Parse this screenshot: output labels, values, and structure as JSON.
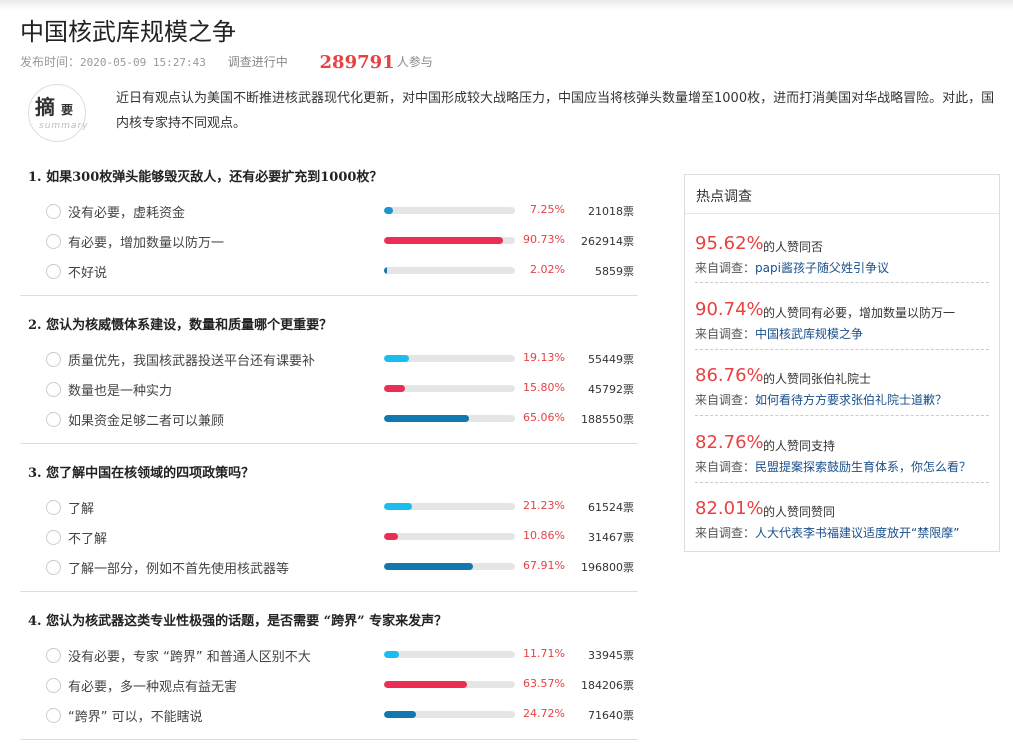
{
  "page": {
    "title": "中国核武库规模之争",
    "meta": {
      "time_label": "发布时间：",
      "time": "2020-05-09 15:27:43",
      "status": "调查进行中",
      "participants": "289791",
      "participants_unit": "人参与"
    },
    "summary": {
      "badge_big": "摘",
      "badge_small": "要",
      "badge_en": "summary",
      "text": "近日有观点认为美国不断推进核武器现代化更新，对中国形成较大战略压力，中国应当将核弹头数量增至1000枚，进而打消美国对华战略冒险。对此，国内核专家持不同观点。"
    }
  },
  "questions": [
    {
      "title": "1. 如果300枚弹头能够毁灭敌人，还有必要扩充到1000枚？",
      "options": [
        {
          "label": "没有必要，虚耗资金",
          "percent_text": "7.25%",
          "percent": 7.25,
          "votes": "21018票",
          "color": "#1a96d4"
        },
        {
          "label": "有必要，增加数量以防万一",
          "percent_text": "90.73%",
          "percent": 90.73,
          "votes": "262914票",
          "color": "#ec2d54"
        },
        {
          "label": "不好说",
          "percent_text": "2.02%",
          "percent": 2.02,
          "votes": "5859票",
          "color": "#1278b0"
        }
      ]
    },
    {
      "title": "2. 您认为核威慑体系建设，数量和质量哪个更重要？",
      "options": [
        {
          "label": "质量优先，我国核武器投送平台还有课要补",
          "percent_text": "19.13%",
          "percent": 19.13,
          "votes": "55449票",
          "color": "#19bdf0"
        },
        {
          "label": "数量也是一种实力",
          "percent_text": "15.80%",
          "percent": 15.8,
          "votes": "45792票",
          "color": "#ec2d54"
        },
        {
          "label": "如果资金足够二者可以兼顾",
          "percent_text": "65.06%",
          "percent": 65.06,
          "votes": "188550票",
          "color": "#1278b0"
        }
      ]
    },
    {
      "title": "3. 您了解中国在核领域的四项政策吗？",
      "options": [
        {
          "label": "了解",
          "percent_text": "21.23%",
          "percent": 21.23,
          "votes": "61524票",
          "color": "#19bdf0"
        },
        {
          "label": "不了解",
          "percent_text": "10.86%",
          "percent": 10.86,
          "votes": "31467票",
          "color": "#ec2d54"
        },
        {
          "label": "了解一部分，例如不首先使用核武器等",
          "percent_text": "67.91%",
          "percent": 67.91,
          "votes": "196800票",
          "color": "#1278b0"
        }
      ]
    },
    {
      "title": "4. 您认为核武器这类专业性极强的话题，是否需要 “跨界” 专家来发声？",
      "options": [
        {
          "label": "没有必要，专家 “跨界” 和普通人区别不大",
          "percent_text": "11.71%",
          "percent": 11.71,
          "votes": "33945票",
          "color": "#19bdf0"
        },
        {
          "label": "有必要，多一种观点有益无害",
          "percent_text": "63.57%",
          "percent": 63.57,
          "votes": "184206票",
          "color": "#ec2d54"
        },
        {
          "label": "“跨界” 可以，不能瞎说",
          "percent_text": "24.72%",
          "percent": 24.72,
          "votes": "71640票",
          "color": "#1278b0"
        }
      ]
    }
  ],
  "hot": {
    "title": "热点调查",
    "items": [
      {
        "percent": "95.62%",
        "text": "的人赞同否",
        "source_label": "来自调查：",
        "source": "papi酱孩子随父姓引争议"
      },
      {
        "percent": "90.74%",
        "text": "的人赞同有必要，增加数量以防万一",
        "source_label": "来自调查：",
        "source": "中国核武库规模之争"
      },
      {
        "percent": "86.76%",
        "text": "的人赞同张伯礼院士",
        "source_label": "来自调查：",
        "source": "如何看待方方要求张伯礼院士道歉？"
      },
      {
        "percent": "82.76%",
        "text": "的人赞同支持",
        "source_label": "来自调查：",
        "source": "民盟提案探索鼓励生育体系，你怎么看？"
      },
      {
        "percent": "82.01%",
        "text": "的人赞同赞同",
        "source_label": "来自调查：",
        "source": "人大代表李书福建议适度放开“禁限摩”"
      }
    ]
  }
}
